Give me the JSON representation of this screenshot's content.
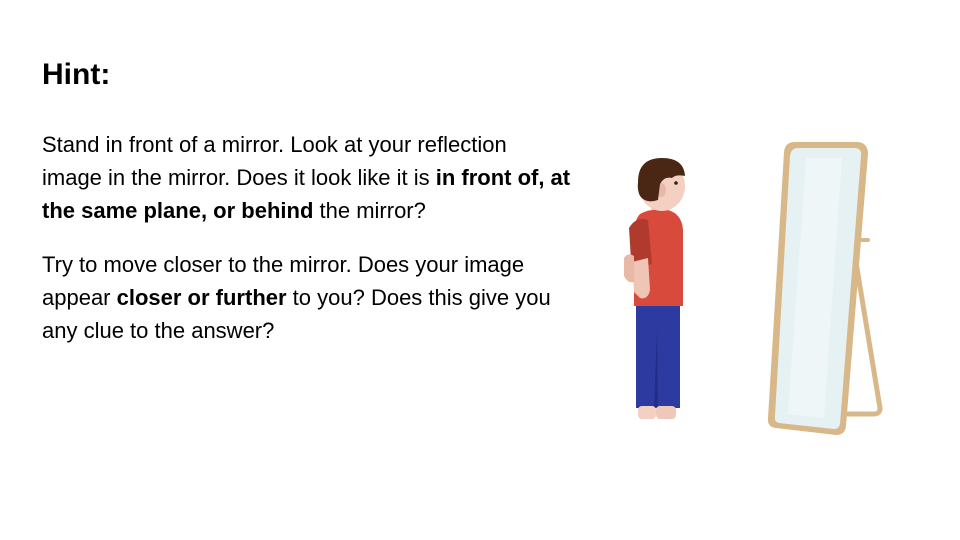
{
  "slide": {
    "title": "Hint:",
    "paragraph1": {
      "part1": "Stand in front of a mirror. Look at your reflection image in the mirror. Does it look like it is ",
      "bold": "in front of, at the same plane, or behind",
      "part2": " the mirror?"
    },
    "paragraph2": {
      "part1": "Try to move closer to the mirror. Does your image appear ",
      "bold": "closer or further",
      "part2": " to you? Does this give you any clue to the answer?"
    }
  },
  "illustration": {
    "person_icon": "standing-person-icon",
    "mirror_icon": "floor-mirror-icon",
    "colors": {
      "hair": "#4a2614",
      "skin": "#f3d0c2",
      "shirt": "#d84a3c",
      "shirt_shadow": "#b13a2f",
      "pants": "#2d3aa0",
      "pants_shadow": "#232d84",
      "mirror_frame": "#d8b889",
      "mirror_glass": "#e6f1f3"
    }
  }
}
